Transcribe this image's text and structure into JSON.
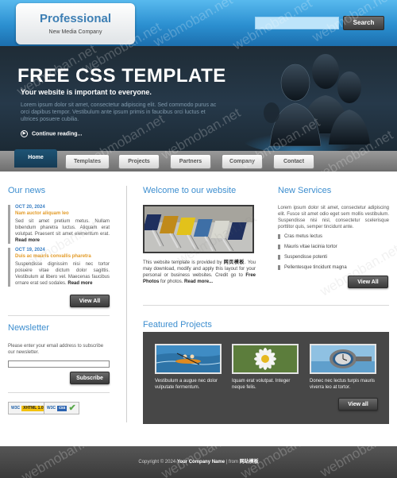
{
  "header": {
    "logo_title": "Professional",
    "logo_subtitle": "New Media Company",
    "search_placeholder": "",
    "search_button": "Search"
  },
  "hero": {
    "title": "FREE CSS TEMPLATE",
    "subtitle": "Your website is important to everyone.",
    "text": "Lorem ipsum dolor sit amet, consectetur adipiscing elit. Sed commodo purus ac orci dapibus tempor. Vestibulum ante ipsum primis in faucibus orci luctus et ultrices posuere cubilia.",
    "more_label": "Continue reading..."
  },
  "nav": {
    "items": [
      "Home",
      "Templates",
      "Projects",
      "Partners",
      "Company",
      "Contact"
    ]
  },
  "news": {
    "title": "Our news",
    "items": [
      {
        "date": "OCT 20, 2024",
        "headline": "Nam auctor aliquam leo",
        "body": "Sed sit amet pretium metus. Nullam bibendum pharetra luctus. Aliquam erat volutpat. Praesent sit amet elementum erat.",
        "more": "Read more"
      },
      {
        "date": "OCT 19, 2024",
        "headline": "Duis ac mauris convallis pharetra",
        "body": "Suspendisse dignissim nisi nec tortor posuere vitae dictum dolor sagittis. Vestibulum at libero vel. Maecenas faucibus ornare erat sed sodales.",
        "more": "Read more"
      }
    ],
    "view_all": "View All"
  },
  "newsletter": {
    "title": "Newsletter",
    "text": "Please enter your email address to subscribe our newsletter.",
    "input_value": "",
    "subscribe": "Subscribe"
  },
  "badges": {
    "xhtml_w3c": "W3C",
    "xhtml_tag": "XHTML 1.0",
    "css_w3c": "W3C",
    "css_tag": "css"
  },
  "welcome": {
    "title": "Welcome to our website",
    "text_before": "This website template is provided by ",
    "provider": "网页模板",
    "text_middle": ". You may download, modify and apply this layout for your personal or business websites. Credit go to ",
    "credit": "Free Photos",
    "text_after": " for photos. ",
    "more": "Read more..."
  },
  "services": {
    "title": "New Services",
    "text": "Lorem ipsum dolor sit amet, consectetur adipiscing elit. Fusce sit amet odio eget sem mollis vestibulum. Suspendisse nisi nisl, consectetur scelerisque porttitor quis, semper tincidunt ante.",
    "items": [
      "Cras metus lectus",
      "Mauris vitae lacinia tortor",
      "Suspendisse potenti",
      "Pellentesque tincidunt magna"
    ],
    "view_all": "View All"
  },
  "featured": {
    "title": "Featured Projects",
    "items": [
      {
        "text": "Vestibulum a augue nec dolor vulputate fermentum."
      },
      {
        "text": "Iquam erat volutpat. Integer neque felis."
      },
      {
        "text": "Donec nec lectus turpis mauris viverra leo at tortor."
      }
    ],
    "view_all": "View all"
  },
  "footer": {
    "prefix": "Copyright © 2024 ",
    "company": "Your Company Name",
    "middle": " | from ",
    "source": "网站模板"
  },
  "watermark": "webmoban.net",
  "colors": {
    "accent_blue": "#3d8ecf",
    "orange": "#e39b27",
    "dark_gray": "#474747"
  }
}
